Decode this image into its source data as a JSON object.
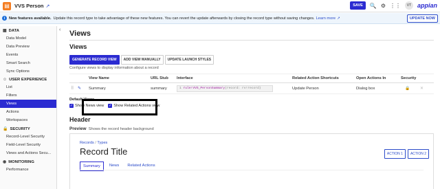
{
  "topbar": {
    "record_name": "VVS Person",
    "save_label": "SAVE",
    "avatar_initials": "VT",
    "logo_text": "appian"
  },
  "banner": {
    "bold_text": "New features available.",
    "message": "Update this record type to take advantage of these new features. You can revert the update afterwards by closing the record type without saving changes.",
    "learn_more": "Learn more",
    "update_button": "UPDATE NOW"
  },
  "sidebar": {
    "sections": [
      {
        "title": "DATA",
        "icon": "database-icon",
        "items": [
          "Data Model",
          "Data Preview",
          "Events",
          "Smart Search",
          "Sync Options"
        ]
      },
      {
        "title": "USER EXPERIENCE",
        "icon": "user-icon",
        "items": [
          "List",
          "Filters",
          "Views",
          "Actions",
          "Workspaces"
        ]
      },
      {
        "title": "SECURITY",
        "icon": "lock-icon",
        "items": [
          "Record-Level Security",
          "Field-Level Security",
          "Views and Actions Secu..."
        ]
      },
      {
        "title": "MONITORING",
        "icon": "monitor-icon",
        "items": [
          "Performance"
        ]
      }
    ],
    "active_item": "Views"
  },
  "main": {
    "page_title": "Views",
    "section_title": "Views",
    "buttons": {
      "generate": "GENERATE RECORD VIEW",
      "add_manual": "ADD VIEW MANUALLY",
      "update_launch": "UPDATE LAUNCH STYLES"
    },
    "description": "Configure views to display information about a record",
    "table": {
      "headers": [
        "View Name",
        "URL Stub",
        "Interface",
        "Related Action Shortcuts",
        "Open Actions In",
        "Security"
      ],
      "rows": [
        {
          "view_name": "Summary",
          "url_stub": "summary",
          "interface_line": "1",
          "interface_fn": "rule!VVS_PersonSummary",
          "interface_args": "(record: rv!record)",
          "shortcut": "Update Person",
          "open_in": "Dialog box"
        }
      ]
    },
    "default_views": {
      "label": "Default Views",
      "show_news": "Show News view",
      "show_related": "Show Related Actions view"
    },
    "header_title": "Header",
    "preview": {
      "label": "Preview",
      "description": "Shows the record header background",
      "crumb_records": "Records",
      "crumb_sep": "/",
      "crumb_types": "Types",
      "record_title": "Record Title",
      "action1": "ACTION 1",
      "action2": "ACTION 2",
      "tabs": [
        "Summary",
        "News",
        "Related Actions"
      ]
    }
  }
}
